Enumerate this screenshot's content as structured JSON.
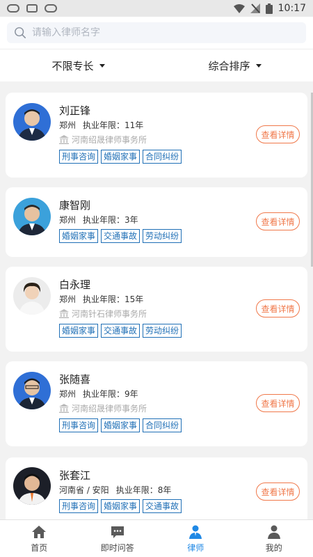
{
  "status_bar": {
    "time": "10:17"
  },
  "search": {
    "placeholder": "请输入律师名字"
  },
  "filters": {
    "specialty": "不限专长",
    "sort": "综合排序"
  },
  "lawyers": [
    {
      "name": "刘正锋",
      "city": "郑州",
      "years": "执业年限：11年",
      "firm": "河南绍晟律师事务所",
      "tags": [
        "刑事咨询",
        "婚姻家事",
        "合同纠纷"
      ],
      "detail_label": "查看详情"
    },
    {
      "name": "康智刚",
      "city": "郑州",
      "years": "执业年限：3年",
      "firm": "",
      "tags": [
        "婚姻家事",
        "交通事故",
        "劳动纠纷"
      ],
      "detail_label": "查看详情"
    },
    {
      "name": "白永理",
      "city": "郑州",
      "years": "执业年限：15年",
      "firm": "河南针石律师事务所",
      "tags": [
        "婚姻家事",
        "交通事故",
        "劳动纠纷"
      ],
      "detail_label": "查看详情"
    },
    {
      "name": "张随喜",
      "city": "郑州",
      "years": "执业年限：9年",
      "firm": "河南绍晟律师事务所",
      "tags": [
        "刑事咨询",
        "婚姻家事",
        "合同纠纷"
      ],
      "detail_label": "查看详情"
    },
    {
      "name": "张套江",
      "city": "河南省 / 安阳",
      "years": "执业年限：8年",
      "firm": "",
      "tags": [
        "刑事咨询",
        "婚姻家事",
        "交通事故"
      ],
      "detail_label": "查看详情"
    }
  ],
  "tabbar": [
    {
      "label": "首页",
      "icon": "home-icon",
      "active": false
    },
    {
      "label": "即时问答",
      "icon": "chat-icon",
      "active": false
    },
    {
      "label": "律师",
      "icon": "lawyer-icon",
      "active": true
    },
    {
      "label": "我的",
      "icon": "profile-icon",
      "active": false
    }
  ],
  "colors": {
    "accent": "#1f88e5",
    "tag": "#1f6fb6",
    "detail": "#f0784a"
  }
}
